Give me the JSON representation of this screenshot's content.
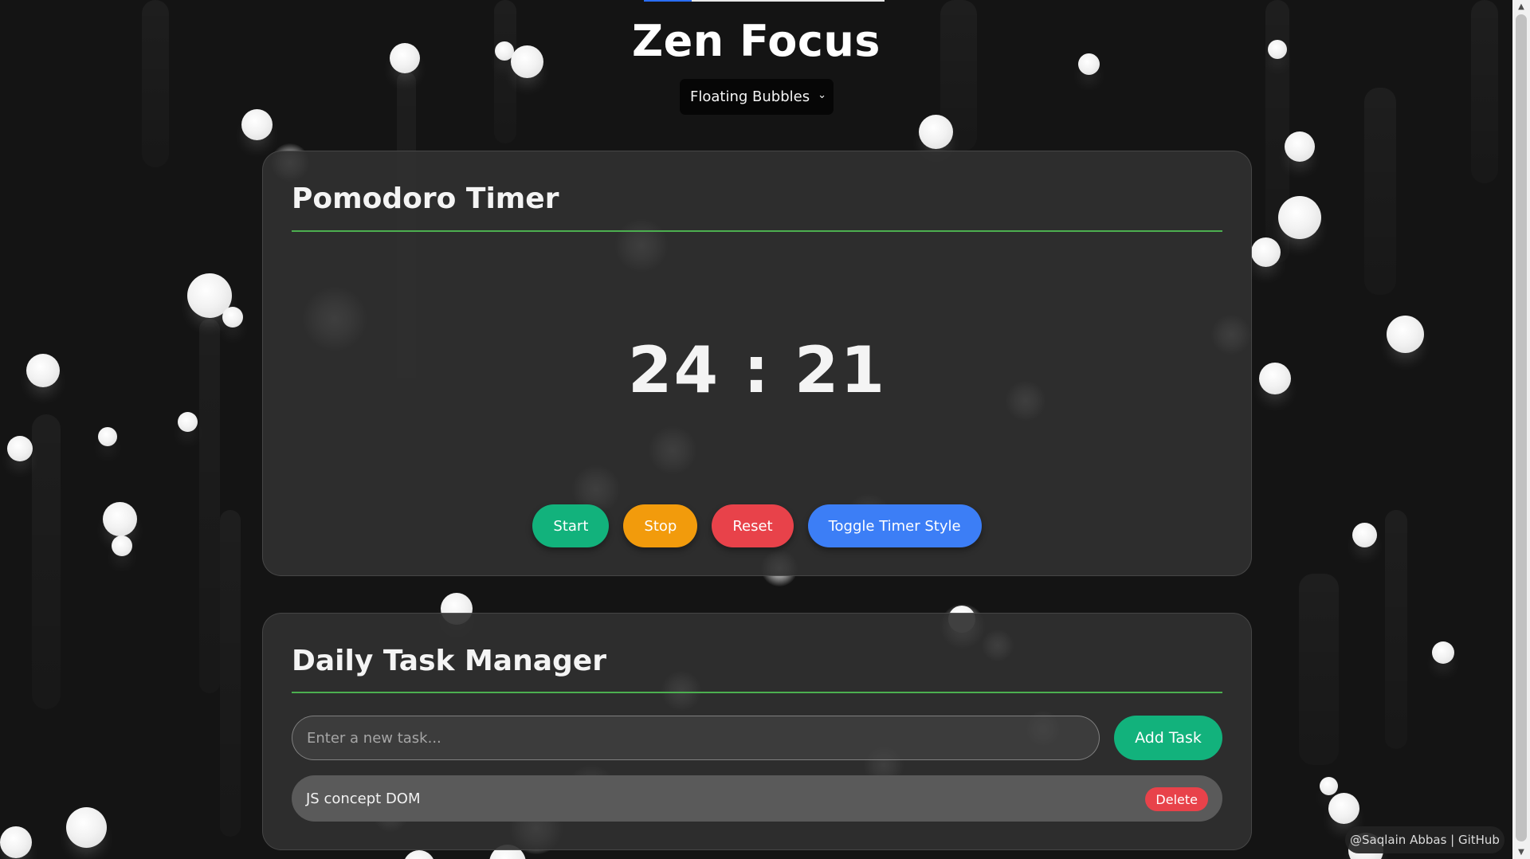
{
  "app": {
    "title": "Zen Focus",
    "theme_select": {
      "selected": "Floating Bubbles"
    }
  },
  "pomodoro": {
    "heading": "Pomodoro Timer",
    "time_display": "24 : 21",
    "buttons": {
      "start": "Start",
      "stop": "Stop",
      "reset": "Reset",
      "toggle": "Toggle Timer Style"
    }
  },
  "tasks": {
    "heading": "Daily Task Manager",
    "input_placeholder": "Enter a new task...",
    "add_label": "Add Task",
    "items": [
      {
        "text": "JS concept DOM",
        "delete_label": "Delete"
      }
    ]
  },
  "footer": {
    "credit": "@Saqlain Abbas | GitHub"
  },
  "colors": {
    "start": "#12b27c",
    "stop": "#f29b0c",
    "reset": "#e8424a",
    "toggle": "#3c7ef6",
    "rule": "#4caf50",
    "background": "#141414"
  },
  "icons": {
    "select_chevron": "chevron-down-icon"
  }
}
